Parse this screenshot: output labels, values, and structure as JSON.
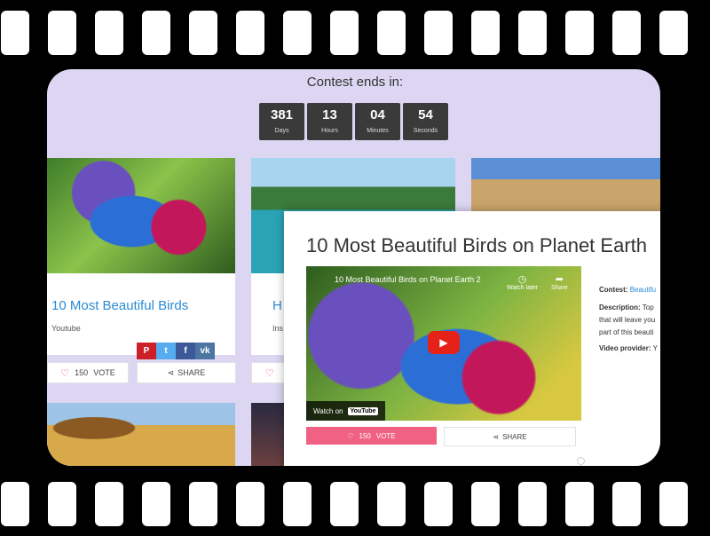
{
  "contest": {
    "title": "Contest ends in:",
    "countdown": [
      {
        "value": "381",
        "label": "Days"
      },
      {
        "value": "13",
        "label": "Hours"
      },
      {
        "value": "04",
        "label": "Minutes"
      },
      {
        "value": "54",
        "label": "Seconds"
      }
    ]
  },
  "cards": [
    {
      "title": "10 Most Beautiful Birds",
      "source": "Youtube",
      "votes": "150",
      "vote_label": "VOTE",
      "share_label": "SHARE"
    },
    {
      "title": "H",
      "source": "Ins"
    }
  ],
  "social": [
    {
      "icon": "pinterest-icon",
      "glyph": "P",
      "color": "#cb2027"
    },
    {
      "icon": "twitter-icon",
      "glyph": "t",
      "color": "#55acee"
    },
    {
      "icon": "facebook-icon",
      "glyph": "f",
      "color": "#3b5998"
    },
    {
      "icon": "vk-icon",
      "glyph": "vk",
      "color": "#4c75a3"
    }
  ],
  "popup": {
    "title": "10 Most Beautiful Birds on Planet Earth",
    "video_title": "10 Most Beautiful Birds on Planet Earth 2",
    "watch_later": "Watch later",
    "share": "Share",
    "watch_on": "Watch on",
    "youtube": "YouTube",
    "contest_label": "Contest:",
    "contest_value": "Beautifu",
    "description_label": "Description:",
    "description_lines": [
      "Top",
      "that will leave you",
      "part of this beauti"
    ],
    "provider_label": "Video provider:",
    "provider_value": "Y",
    "votes": "150",
    "vote_label": "VOTE",
    "share_label": "SHARE"
  }
}
